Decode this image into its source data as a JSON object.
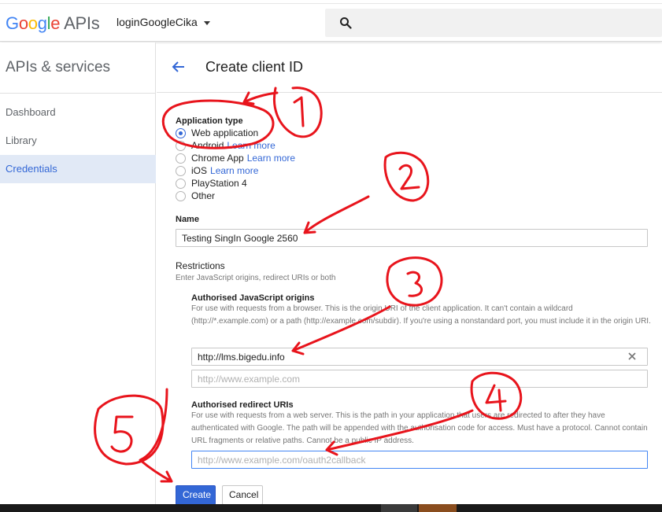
{
  "topbar": {
    "logo_letters": [
      "G",
      "o",
      "o",
      "g",
      "l",
      "e"
    ],
    "logo_suffix": "APIs",
    "project_name": "loginGoogleCika",
    "search_icon": "search-icon",
    "dropdown_icon": "caret-down-icon"
  },
  "sidebar": {
    "title": "APIs & services",
    "items": [
      {
        "label": "Dashboard",
        "active": false
      },
      {
        "label": "Library",
        "active": false
      },
      {
        "label": "Credentials",
        "active": true
      }
    ]
  },
  "page": {
    "back_icon": "arrow-back-icon",
    "title": "Create client ID"
  },
  "application_type": {
    "label": "Application type",
    "options": [
      {
        "label": "Web application",
        "link": "",
        "checked": true
      },
      {
        "label": "Android",
        "link": "Learn more",
        "checked": false
      },
      {
        "label": "Chrome App",
        "link": "Learn more",
        "checked": false
      },
      {
        "label": "iOS",
        "link": "Learn more",
        "checked": false
      },
      {
        "label": "PlayStation 4",
        "link": "",
        "checked": false
      },
      {
        "label": "Other",
        "link": "",
        "checked": false
      }
    ]
  },
  "name_field": {
    "label": "Name",
    "value": "Testing SingIn Google 2560"
  },
  "restrictions": {
    "title": "Restrictions",
    "subtitle": "Enter JavaScript origins, redirect URIs or both",
    "js_origins": {
      "title": "Authorised JavaScript origins",
      "help": "For use with requests from a browser. This is the origin URI of the client application. It can't contain a wildcard (http://*.example.com) or a path (http://example.com/subdir). If you're using a nonstandard port, you must include it in the origin URI.",
      "entries": [
        "http://lms.bigedu.info"
      ],
      "placeholder": "http://www.example.com",
      "clear_icon": "close-icon"
    },
    "redirect_uris": {
      "title": "Authorised redirect URIs",
      "help": "For use with requests from a web server. This is the path in your application that users are redirected to after they have authenticated with Google. The path will be appended with the authorisation code for access. Must have a protocol. Cannot contain URL fragments or relative paths. Cannot be a public IP address.",
      "placeholder": "http://www.example.com/oauth2callback"
    }
  },
  "actions": {
    "create": "Create",
    "cancel": "Cancel"
  },
  "annotations": {
    "ink_color": "#e8141c",
    "marks": [
      "1",
      "2",
      "3",
      "4",
      "5"
    ]
  }
}
